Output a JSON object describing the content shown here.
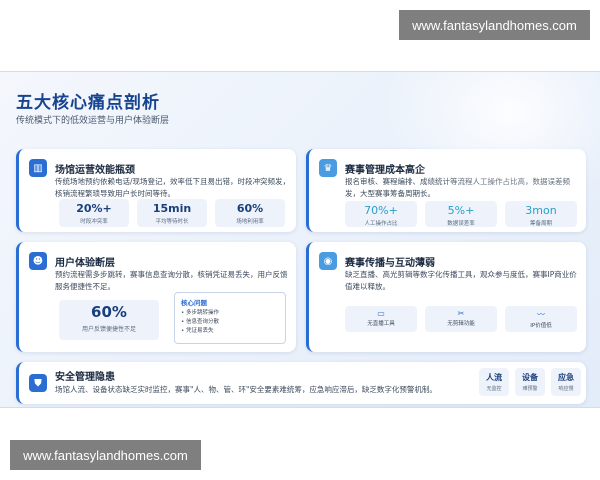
{
  "watermark": "www.fantasylandhomes.com",
  "slide": {
    "title": "五大核心痛点剖析",
    "subtitle": "传统模式下的低效运营与用户体验断层"
  },
  "venue": {
    "title": "场馆运营效能瓶颈",
    "icon": "building-icon",
    "desc": "传统场地预约依赖电话/现场登记，效率低下且易出错，时段冲突频发，核销流程繁琐导致用户长时间等待。",
    "stats": [
      {
        "value": "20%+",
        "label": "时段冲突率"
      },
      {
        "value": "15min",
        "label": "平均等待时长"
      },
      {
        "value": "60%",
        "label": "场地利用率"
      }
    ]
  },
  "event_cost": {
    "title": "赛事管理成本高企",
    "icon": "trophy-icon",
    "desc": "报名审核、赛程编排、成绩统计等流程人工操作占比高，数据误差频发，大型赛事筹备周期长。",
    "stats": [
      {
        "value": "70%+",
        "label": "人工操作占比"
      },
      {
        "value": "5%+",
        "label": "数据误差率"
      },
      {
        "value": "3mon",
        "label": "筹备周期"
      }
    ]
  },
  "user_exp": {
    "title": "用户体验断层",
    "icon": "user-icon",
    "desc": "预约流程需多步跳转，赛事信息查询分散，核销凭证易丢失，用户反馈服务便捷性不足。",
    "big_stat": {
      "value": "60%",
      "label": "用户反馈便捷性不足"
    },
    "core": {
      "heading": "核心问题",
      "items": [
        "• 多步跳转操作",
        "• 信息查询分散",
        "• 凭证易丢失"
      ]
    }
  },
  "broadcast": {
    "title": "赛事传播与互动薄弱",
    "icon": "broadcast-icon",
    "desc": "缺乏直播、高光剪辑等数字化传播工具，观众参与度低，赛事IP商业价值难以释放。",
    "tools": [
      {
        "icon": "video-icon",
        "glyph": "▭",
        "label": "无直播工具"
      },
      {
        "icon": "scissors-icon",
        "glyph": "✂",
        "label": "无剪辑功能"
      },
      {
        "icon": "chart-icon",
        "glyph": "〰",
        "label": "IP价值低"
      }
    ]
  },
  "security": {
    "title": "安全管理隐患",
    "icon": "shield-icon",
    "desc": "场馆人流、设备状态缺乏实时监控，赛事\"人、物、管、环\"安全要素难统筹，应急响应滞后，缺乏数字化预警机制。",
    "chips": [
      {
        "value": "人流",
        "label": "无监控"
      },
      {
        "value": "设备",
        "label": "难预警"
      },
      {
        "value": "应急",
        "label": "响应慢"
      }
    ]
  }
}
